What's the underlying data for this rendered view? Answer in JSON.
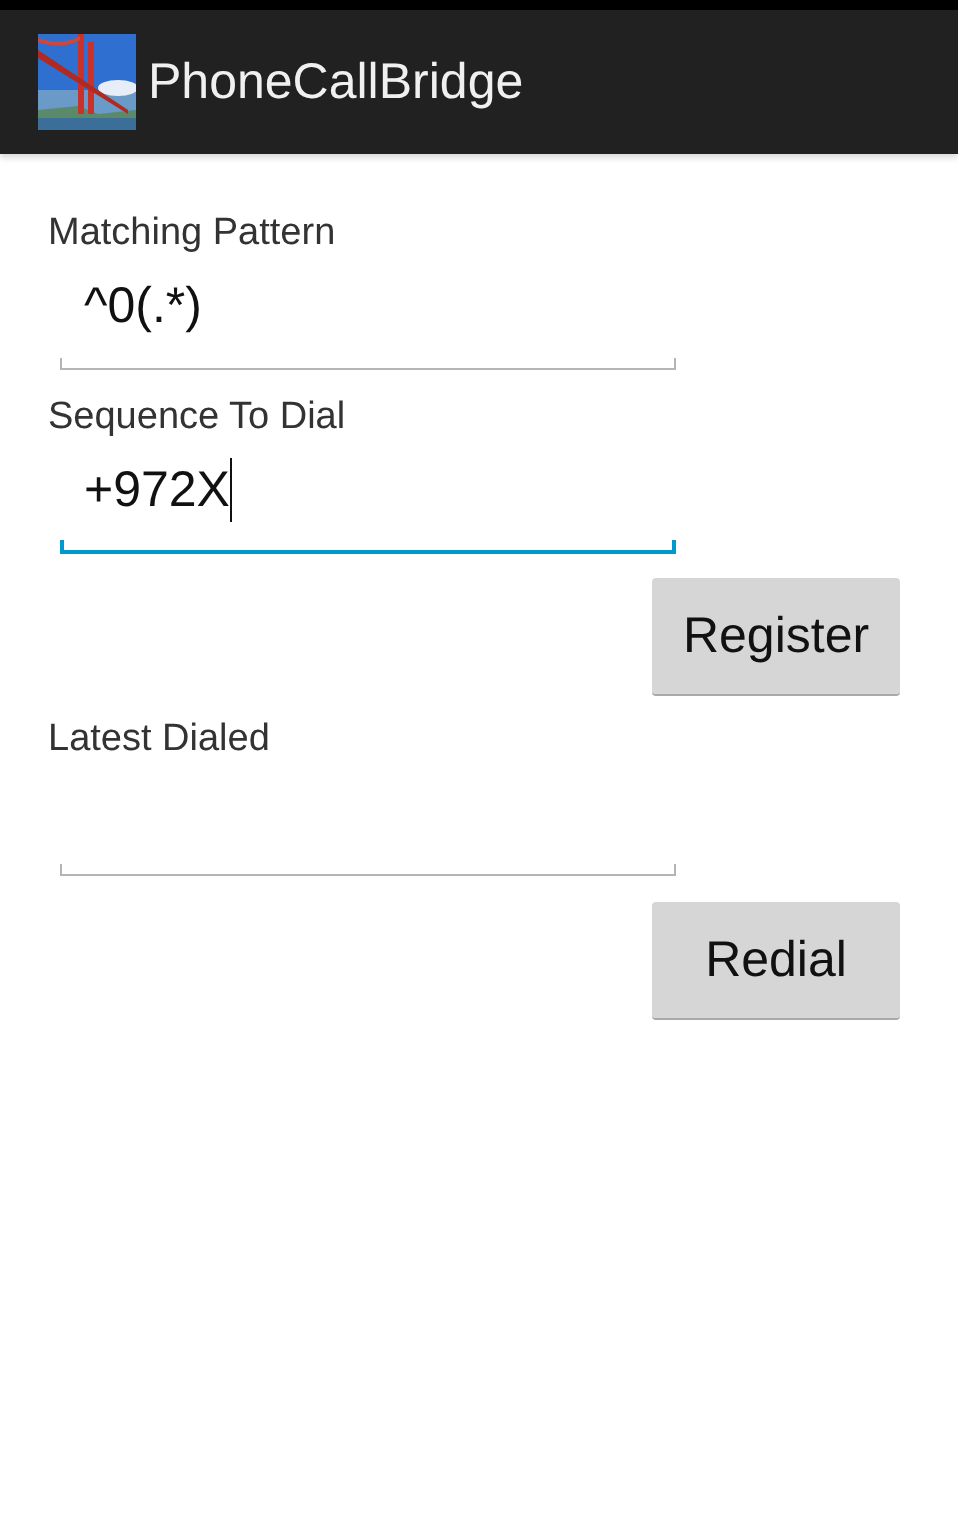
{
  "action_bar": {
    "title": "PhoneCallBridge"
  },
  "form": [
    {
      "kind": "label",
      "text": "Matching Pattern"
    },
    {
      "kind": "field",
      "value": "^0(.*)",
      "focused": false
    },
    {
      "kind": "label",
      "text": "Sequence To Dial"
    },
    {
      "kind": "field",
      "value": "+972X",
      "focused": true
    },
    {
      "kind": "button",
      "text": "Register"
    },
    {
      "kind": "label",
      "text": "Latest Dialed"
    },
    {
      "kind": "field",
      "focused": false
    },
    {
      "kind": "button",
      "text": "Redial"
    }
  ]
}
